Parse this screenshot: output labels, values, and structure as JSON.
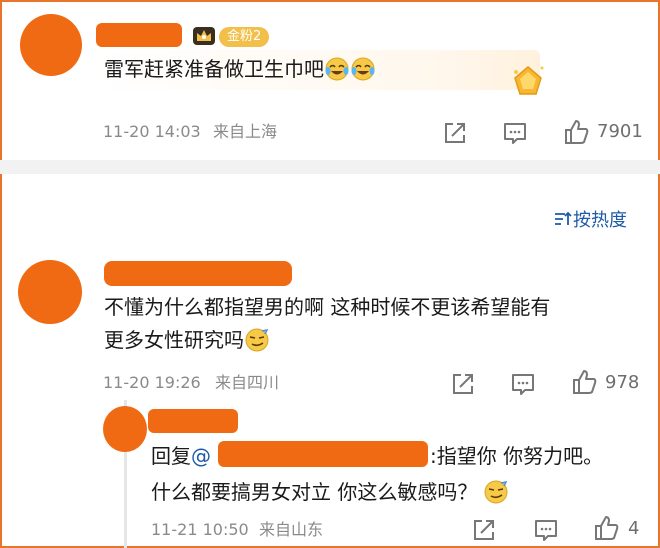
{
  "comment_1": {
    "badge": "金粉2",
    "text": "雷军赶紧准备做卫生巾吧",
    "time": "11-20 14:03",
    "location": "来自上海",
    "like_count": "7901"
  },
  "sort": {
    "label": "按热度"
  },
  "comment_2": {
    "line1": "不懂为什么都指望男的啊 这种时候不更该希望能有",
    "line2": "更多女性研究吗",
    "time": "11-20 19:26",
    "location": "来自四川",
    "like_count": "978"
  },
  "reply": {
    "prefix": "回复",
    "at": "@",
    "line1_tail": ":指望你 你努力吧。",
    "line2": "什么都要搞男女对立 你这么敏感吗？",
    "time": "11-21 10:50",
    "location": "来自山东",
    "like_count": "4"
  },
  "colors": {
    "redaction": "#f06a14",
    "border": "#e8752c",
    "link": "#1e5aa8",
    "meta": "#8a8a8a"
  },
  "icons": [
    "crown-icon",
    "laugh-cry-emoji",
    "smug-emoji",
    "share-icon",
    "comment-icon",
    "thumbs-up-icon",
    "sort-icon"
  ]
}
